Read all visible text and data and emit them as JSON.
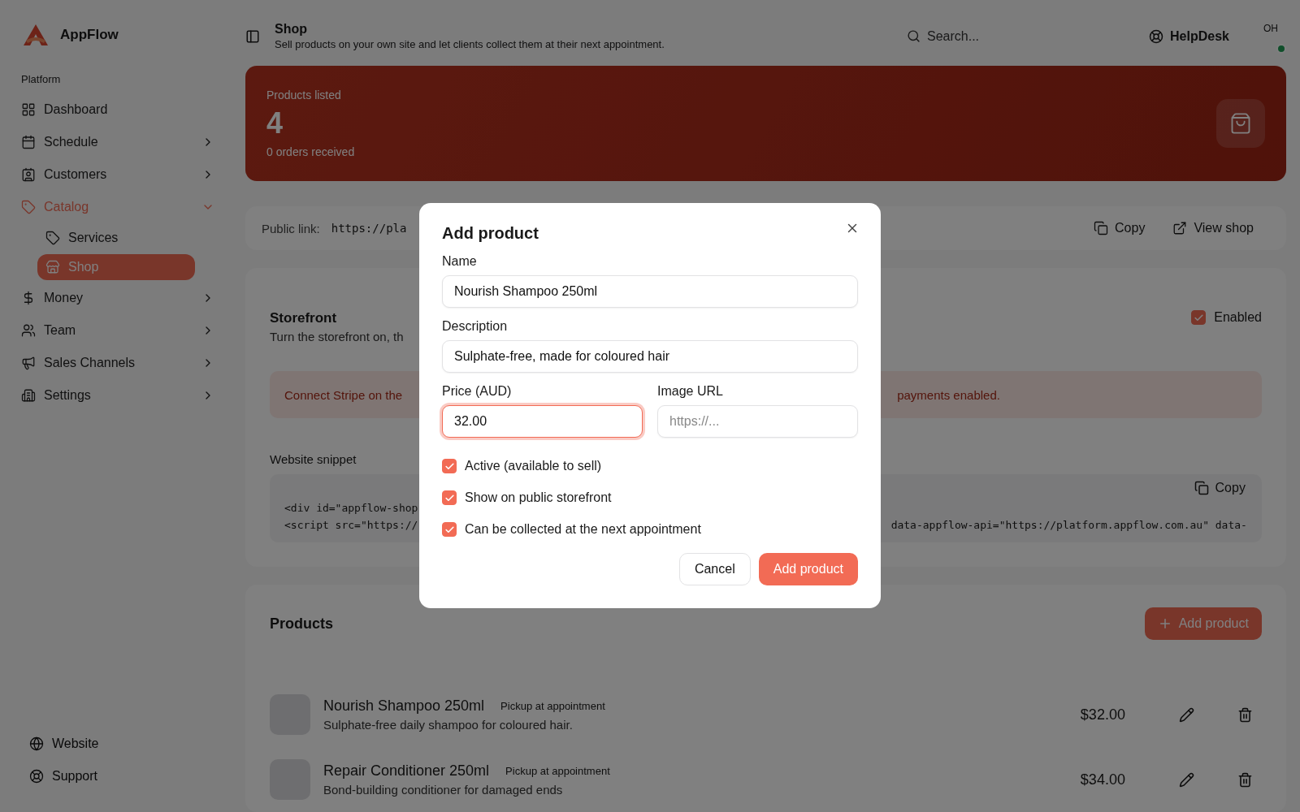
{
  "app": {
    "name": "AppFlow"
  },
  "sidebar": {
    "section": "Platform",
    "items": [
      {
        "label": "Dashboard",
        "chevron": false,
        "selected": false
      },
      {
        "label": "Schedule",
        "chevron": true,
        "selected": false
      },
      {
        "label": "Customers",
        "chevron": true,
        "selected": false
      },
      {
        "label": "Catalog",
        "chevron": true,
        "expanded": true,
        "selected": true,
        "children": [
          {
            "label": "Services",
            "selected": false
          },
          {
            "label": "Shop",
            "selected": true
          }
        ]
      },
      {
        "label": "Money",
        "chevron": true,
        "selected": false
      },
      {
        "label": "Team",
        "chevron": true,
        "selected": false
      },
      {
        "label": "Sales Channels",
        "chevron": true,
        "selected": false
      },
      {
        "label": "Settings",
        "chevron": true,
        "selected": false
      }
    ],
    "footer": [
      {
        "label": "Website"
      },
      {
        "label": "Support"
      }
    ]
  },
  "header": {
    "title": "Shop",
    "subtitle": "Sell products on your own site and let clients collect them at their next appointment.",
    "search_placeholder": "Search...",
    "helpdesk": "HelpDesk",
    "avatar": "OH",
    "online": true
  },
  "stat": {
    "label": "Products listed",
    "value": "4",
    "note": "0 orders received"
  },
  "public_link": {
    "label": "Public link:",
    "url": "https://pla",
    "actions": [
      {
        "label": "Copy"
      },
      {
        "label": "View shop"
      }
    ]
  },
  "storefront": {
    "title": "Storefront",
    "description": "Turn the storefront on, th",
    "enabled_label": "Enabled",
    "enabled": true,
    "alert_left": "Connect Stripe on the ",
    "alert_right": "payments enabled.",
    "snippet_label": "Website snippet",
    "snippet_copy": "Copy",
    "snippet_lines": [
      {
        "left": "<div id=\"appflow-shop"
      },
      {
        "left": "<script src=\"https://",
        "right": "data-appflow-api=\"https://platform.appflow.com.au\" data-"
      }
    ]
  },
  "products": {
    "title": "Products",
    "add_button": "Add product",
    "rows": [
      {
        "name": "Nourish Shampoo 250ml",
        "badge": "Pickup at appointment",
        "description": "Sulphate-free daily shampoo for coloured hair.",
        "price": "$32.00"
      },
      {
        "name": "Repair Conditioner 250ml",
        "badge": "Pickup at appointment",
        "description": "Bond-building conditioner for damaged ends",
        "price": "$34.00"
      }
    ]
  },
  "dialog": {
    "title": "Add product",
    "fields": [
      {
        "label": "Name",
        "value": "Nourish Shampoo 250ml",
        "focused": false
      },
      {
        "label": "Description",
        "value": "Sulphate-free, made for coloured hair",
        "focused": false
      }
    ],
    "pair": [
      {
        "label": "Price (AUD)",
        "value": "32.00",
        "focused": true
      },
      {
        "label": "Image URL",
        "placeholder": "https://...",
        "focused": false
      }
    ],
    "checkboxes": [
      {
        "label": "Active (available to sell)",
        "checked": true
      },
      {
        "label": "Show on public storefront",
        "checked": true
      },
      {
        "label": "Can be collected at the next appointment",
        "checked": true
      }
    ],
    "buttons": [
      {
        "label": "Cancel",
        "kind": "secondary"
      },
      {
        "label": "Add product",
        "kind": "primary"
      }
    ]
  }
}
